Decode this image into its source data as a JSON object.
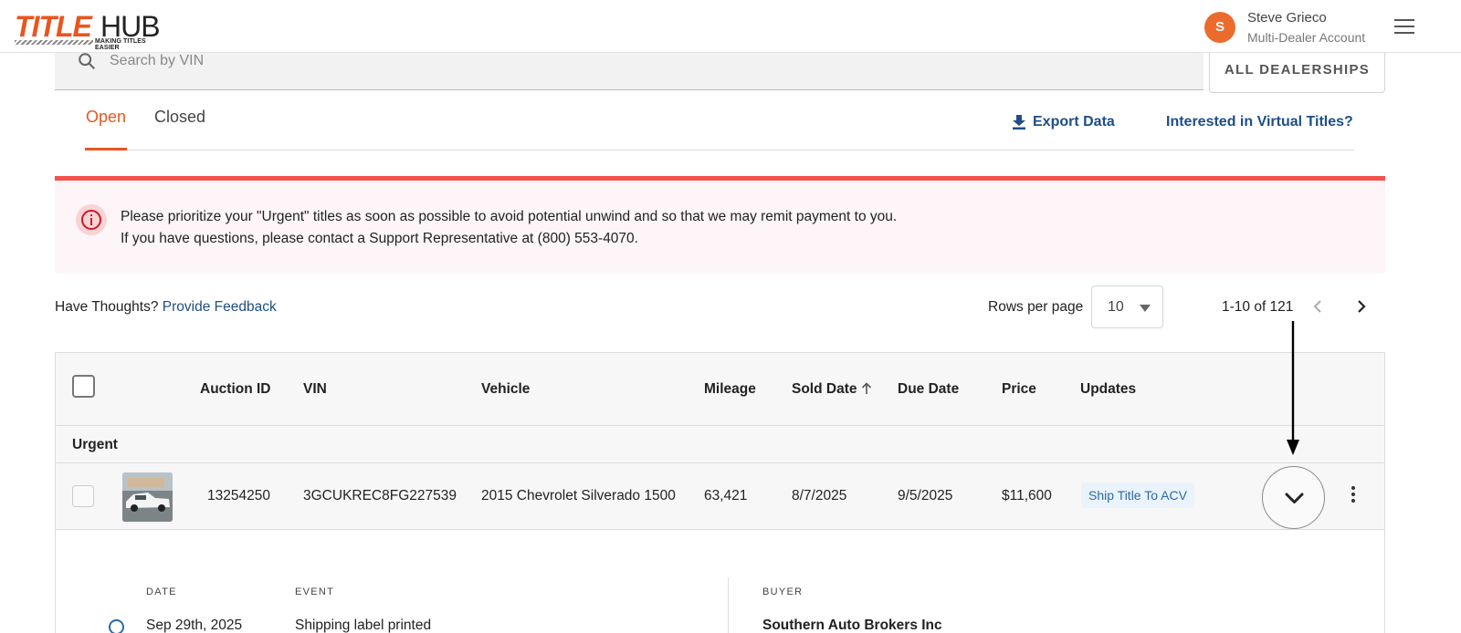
{
  "header": {
    "logo_title": "TITLE",
    "logo_hub": "HUB",
    "logo_tagline": "MAKING TITLES EASIER",
    "avatar_initial": "S",
    "user_name": "Steve Grieco",
    "account_type": "Multi-Dealer Account"
  },
  "search": {
    "placeholder": "Search by VIN",
    "dealership_button": "ALL DEALERSHIPS"
  },
  "tabs": [
    {
      "label": "Open",
      "active": true
    },
    {
      "label": "Closed",
      "active": false
    }
  ],
  "actions": {
    "export": "Export Data",
    "virtual_titles": "Interested in Virtual Titles?"
  },
  "alert": {
    "line1": "Please prioritize your \"Urgent\" titles as soon as possible to avoid potential unwind and so that we may remit payment to you.",
    "line2": "If you have questions, please contact a Support Representative at (800) 553-4070."
  },
  "feedback": {
    "prefix": "Have Thoughts?",
    "link": "Provide Feedback"
  },
  "pagination": {
    "rows_label": "Rows per page",
    "rows_value": "10",
    "range": "1-10 of 121"
  },
  "table": {
    "columns": [
      "Auction ID",
      "VIN",
      "Vehicle",
      "Mileage",
      "Sold Date",
      "Due Date",
      "Price",
      "Updates"
    ],
    "group_label": "Urgent",
    "rows": [
      {
        "auction_id": "13254250",
        "vin": "3GCUKREC8FG227539",
        "vehicle": "2015 Chevrolet Silverado 1500",
        "mileage": "63,421",
        "sold_date": "8/7/2025",
        "due_date": "9/5/2025",
        "price": "$11,600",
        "update": "Ship Title To ACV"
      }
    ]
  },
  "detail": {
    "headers": {
      "date": "DATE",
      "event": "EVENT",
      "buyer": "BUYER"
    },
    "event_date": "Sep 29th, 2025",
    "event_text": "Shipping label printed",
    "buyer_name": "Southern Auto Brokers Inc"
  },
  "colors": {
    "brand_orange": "#e8561f",
    "link_blue": "#1e4e86",
    "alert_red": "#f4524b"
  }
}
